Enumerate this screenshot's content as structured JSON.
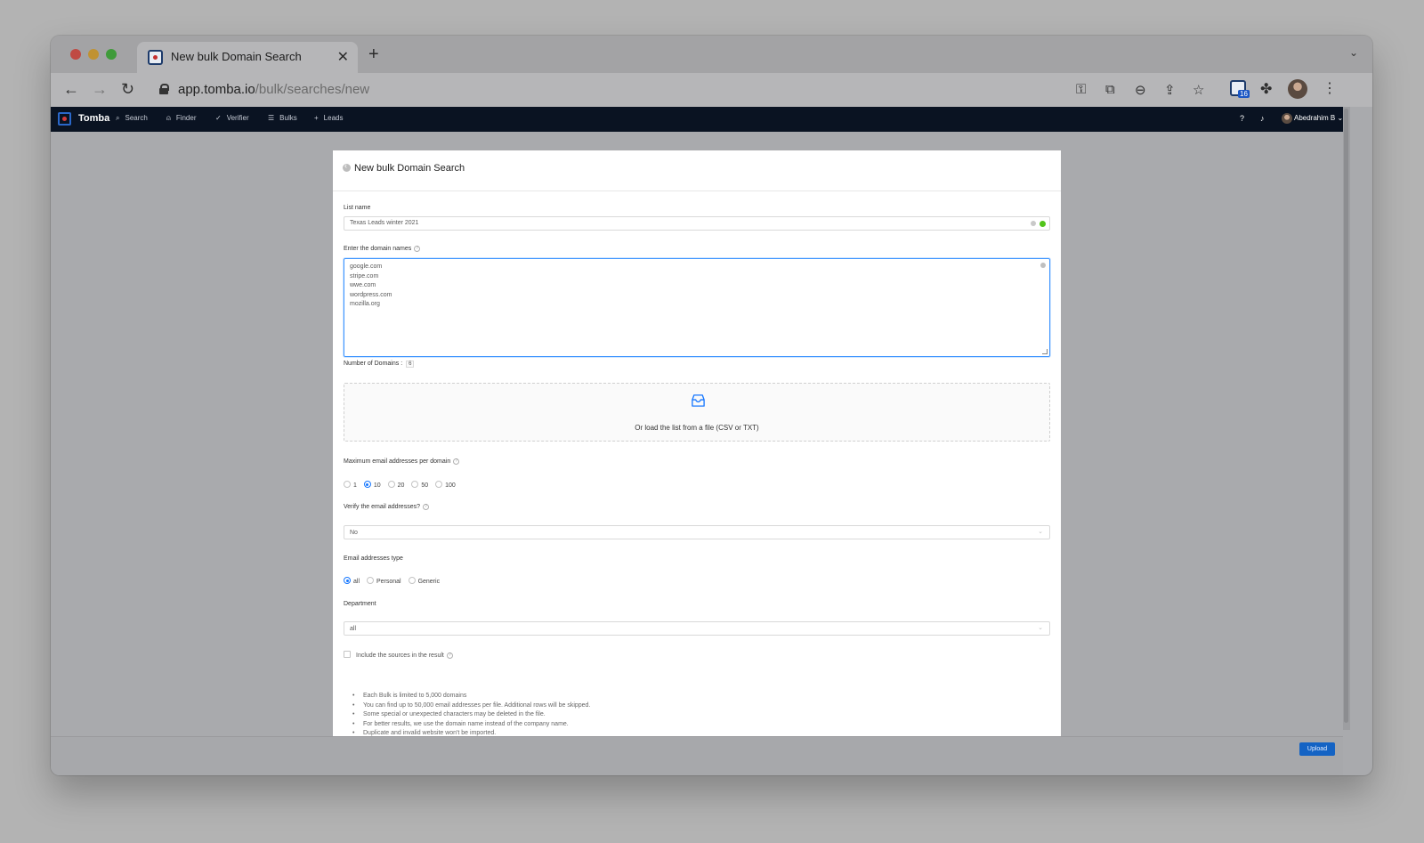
{
  "browser": {
    "tab_title": "New bulk Domain Search",
    "url_host": "app.tomba.io",
    "url_path": "/bulk/searches/new",
    "extension_badge": "16"
  },
  "appbar": {
    "brand": "Tomba",
    "nav": [
      {
        "label": "Search",
        "icon": "search-icon"
      },
      {
        "label": "Finder",
        "icon": "user-icon"
      },
      {
        "label": "Verifier",
        "icon": "check-icon"
      },
      {
        "label": "Bulks",
        "icon": "list-icon"
      },
      {
        "label": "Leads",
        "icon": "plus-icon"
      }
    ],
    "user_name": "Abedrahim B"
  },
  "form": {
    "title": "New bulk Domain Search",
    "list_name_label": "List name",
    "list_name_value": "Texas Leads winter 2021",
    "domains_label": "Enter the domain names",
    "domains": [
      "google.com",
      "stripe.com",
      "wwe.com",
      "wordpress.com",
      "mozilla.org"
    ],
    "domain_count_label": "Number of Domains :",
    "domain_count": "6",
    "upload_text": "Or load the list from a file (CSV or TXT)",
    "max_emails_label": "Maximum email addresses per domain",
    "max_email_options": [
      "1",
      "10",
      "20",
      "50",
      "100"
    ],
    "max_email_selected": "10",
    "verify_label": "Verify the email addresses?",
    "verify_value": "No",
    "email_type_label": "Email addresses type",
    "email_type_options": [
      "all",
      "Personal",
      "Generic"
    ],
    "email_type_selected": "all",
    "department_label": "Department",
    "department_value": "all",
    "include_sources_label": "Include the sources in the result",
    "notes": [
      "Each Bulk is limited to 5,000 domains",
      "You can find up to 50,000 email addresses per file. Additional rows will be skipped.",
      "Some special or unexpected characters may be deleted in the file.",
      "For better results, we use the domain name instead of the company name.",
      "Duplicate and invalid website won't be imported."
    ]
  },
  "footer": {
    "upload_label": "Upload"
  },
  "colors": {
    "primary": "#1677ff",
    "appbar": "#0a1322",
    "success": "#52c41a"
  }
}
